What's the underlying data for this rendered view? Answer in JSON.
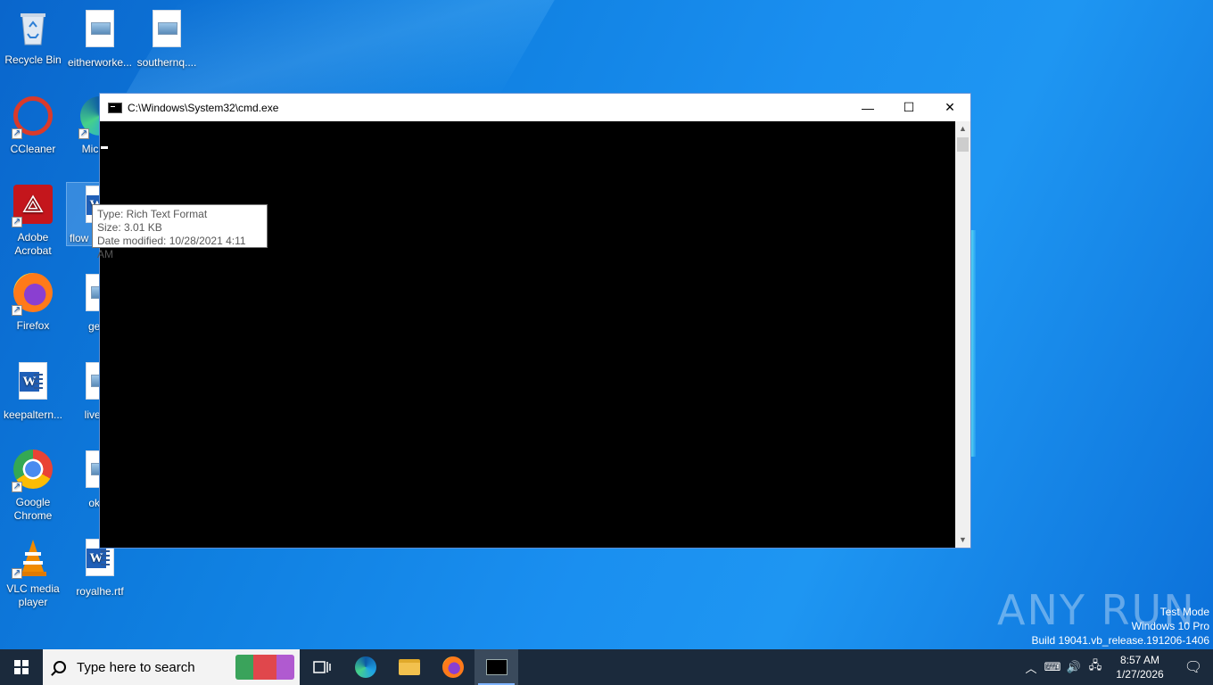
{
  "desktop": {
    "icons": [
      {
        "label": "Recycle Bin"
      },
      {
        "label": "eitherworke..."
      },
      {
        "label": "southernq...."
      },
      {
        "label": "CCleaner"
      },
      {
        "label": "Micr Ed"
      },
      {
        "label": "Adobe Acrobat"
      },
      {
        "label": "flow"
      },
      {
        "label": "Firefox"
      },
      {
        "label": "genti"
      },
      {
        "label": "keepaltern..."
      },
      {
        "label": "liveorc"
      },
      {
        "label": "Google Chrome"
      },
      {
        "label": "okfin"
      },
      {
        "label": "VLC media player"
      },
      {
        "label": "royalhe.rtf"
      }
    ]
  },
  "tooltip": {
    "type": "Type: Rich Text Format",
    "size": "Size: 3.01 KB",
    "modified": "Date modified: 10/28/2021 4:11 AM"
  },
  "window": {
    "title": "C:\\Windows\\System32\\cmd.exe",
    "minimize": "—",
    "maximize": "☐",
    "close": "✕"
  },
  "watermark": {
    "brand": "ANY RUN",
    "mode": "Test Mode",
    "edition": "Windows 10 Pro",
    "build": "Build 19041.vb_release.191206-1406"
  },
  "taskbar": {
    "search_placeholder": "Type here to search",
    "time": "8:57 AM",
    "date": "1/27/2026"
  },
  "colors": {
    "desktop": "#0f7fe0",
    "taskbar": "#1b2a3c",
    "console": "#000000"
  }
}
